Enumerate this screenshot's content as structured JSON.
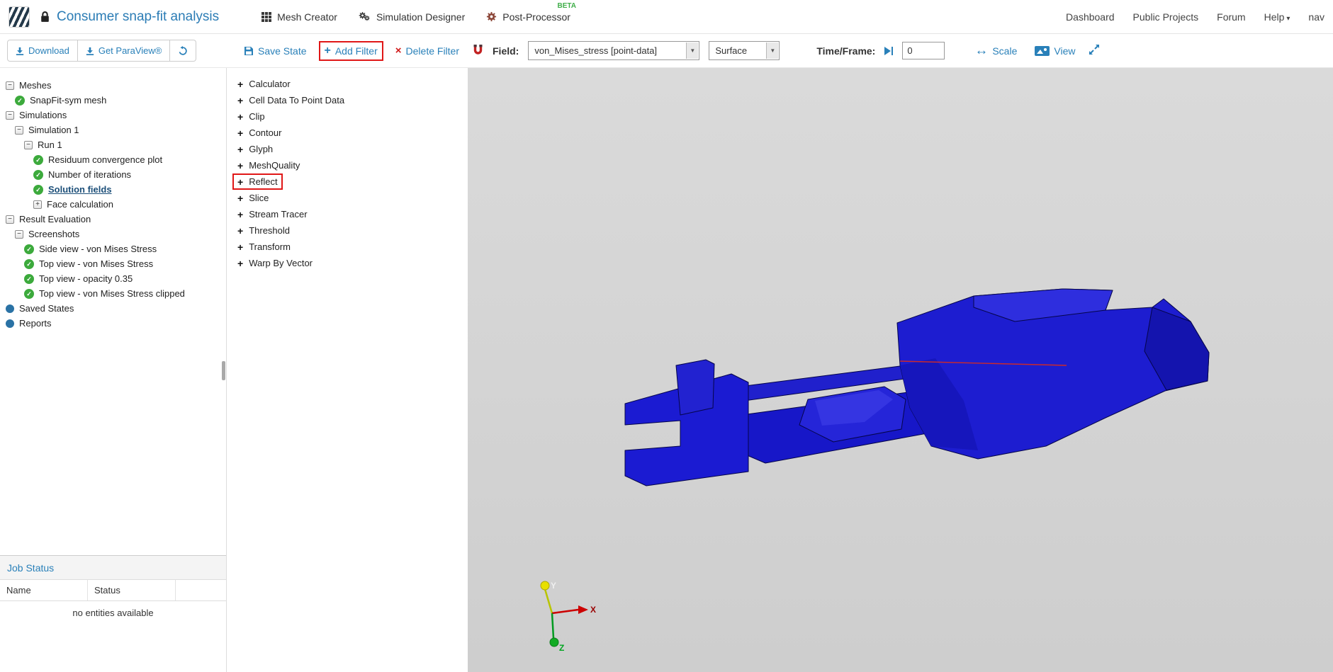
{
  "colors": {
    "accent_blue": "#2980b9",
    "title_blue": "#2b7cb5",
    "check_green": "#3caa3c",
    "beta_green": "#3fae49",
    "annotation_red": "#e01717",
    "model_blue": "#1d1dd0"
  },
  "navbar": {
    "title": "Consumer snap-fit analysis",
    "apps": [
      {
        "label": "Mesh Creator"
      },
      {
        "label": "Simulation Designer"
      },
      {
        "label": "Post-Processor",
        "badge": "BETA"
      }
    ],
    "links": [
      "Dashboard",
      "Public Projects",
      "Forum"
    ],
    "help": "Help",
    "truncated_right": "nav"
  },
  "sidebar_toolbar": {
    "download": "Download",
    "get_paraview": "Get ParaView®"
  },
  "toolbar": {
    "save_state": "Save State",
    "add_filter": "Add Filter",
    "delete_filter": "Delete Filter",
    "field_label": "Field:",
    "field_value": "von_Mises_stress [point-data]",
    "representation": "Surface",
    "time_frame_label": "Time/Frame:",
    "time_value": "0",
    "scale_label": "Scale",
    "view_label": "View"
  },
  "tree": {
    "items": [
      {
        "label": "Meshes",
        "level": 0,
        "icon": "minus"
      },
      {
        "label": "SnapFit-sym mesh",
        "level": 1,
        "icon": "check"
      },
      {
        "label": "Simulations",
        "level": 0,
        "icon": "minus"
      },
      {
        "label": "Simulation 1",
        "level": 1,
        "icon": "minus"
      },
      {
        "label": "Run 1",
        "level": 2,
        "icon": "minus"
      },
      {
        "label": "Residuum convergence plot",
        "level": 3,
        "icon": "check"
      },
      {
        "label": "Number of iterations",
        "level": 3,
        "icon": "check"
      },
      {
        "label": "Solution fields",
        "level": 3,
        "icon": "check",
        "selected": true
      },
      {
        "label": "Face calculation",
        "level": 3,
        "icon": "plus"
      },
      {
        "label": "Result Evaluation",
        "level": 0,
        "icon": "minus"
      },
      {
        "label": "Screenshots",
        "level": 1,
        "icon": "minus"
      },
      {
        "label": "Side view - von Mises Stress",
        "level": 2,
        "icon": "check"
      },
      {
        "label": "Top view - von Mises Stress",
        "level": 2,
        "icon": "check"
      },
      {
        "label": "Top view - opacity 0.35",
        "level": 2,
        "icon": "check"
      },
      {
        "label": "Top view - von Mises Stress clipped",
        "level": 2,
        "icon": "check"
      },
      {
        "label": "Saved States",
        "level": 0,
        "icon": "dot"
      },
      {
        "label": "Reports",
        "level": 0,
        "icon": "dot"
      }
    ]
  },
  "filters": {
    "items": [
      "Calculator",
      "Cell Data To Point Data",
      "Clip",
      "Contour",
      "Glyph",
      "MeshQuality",
      "Reflect",
      "Slice",
      "Stream Tracer",
      "Threshold",
      "Transform",
      "Warp By Vector"
    ],
    "highlighted": "Reflect"
  },
  "job_status": {
    "title": "Job Status",
    "columns": [
      "Name",
      "Status"
    ],
    "empty_text": "no entities available"
  },
  "viewport": {
    "axes": {
      "x": "X",
      "y": "Y",
      "z": "Z"
    }
  }
}
